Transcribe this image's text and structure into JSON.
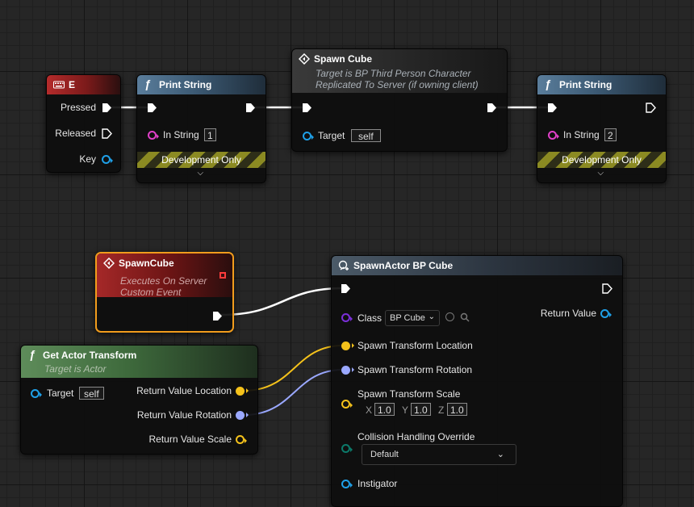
{
  "nodes": {
    "key_e": {
      "title": "E",
      "pins": {
        "pressed": "Pressed",
        "released": "Released",
        "key": "Key"
      }
    },
    "print1": {
      "title": "Print String",
      "in_string_label": "In String",
      "in_string_value": "1",
      "dev": "Development Only"
    },
    "spawn_cube_call": {
      "title": "Spawn Cube",
      "sub1": "Target is BP Third Person Character",
      "sub2": "Replicated To Server (if owning client)",
      "target_label": "Target",
      "target_value": "self"
    },
    "print2": {
      "title": "Print String",
      "in_string_label": "In String",
      "in_string_value": "2",
      "dev": "Development Only"
    },
    "custom_event": {
      "title": "SpawnCube",
      "sub1": "Executes On Server",
      "sub2": "Custom Event"
    },
    "get_transform": {
      "title": "Get Actor Transform",
      "sub": "Target is Actor",
      "target_label": "Target",
      "target_value": "self",
      "out_location": "Return Value Location",
      "out_rotation": "Return Value Rotation",
      "out_scale": "Return Value Scale"
    },
    "spawn_actor": {
      "title": "SpawnActor BP Cube",
      "return_value": "Return Value",
      "class_label": "Class",
      "class_value": "BP Cube",
      "loc": "Spawn Transform Location",
      "rot": "Spawn Transform Rotation",
      "scale": "Spawn Transform Scale",
      "x_label": "X",
      "x_value": "1.0",
      "y_label": "Y",
      "y_value": "1.0",
      "z_label": "Z",
      "z_value": "1.0",
      "collision": "Collision Handling Override",
      "collision_value": "Default",
      "instigator": "Instigator"
    }
  },
  "colors": {
    "exec": "#ffffff",
    "string_pin": "#e040c8",
    "object_pin": "#1fa0e8",
    "class_pin": "#7b2fd9",
    "vector_pin": "#f5c21b",
    "rotator_pin": "#9aa8ff",
    "enum_pin": "#0c7a6a",
    "selected_outline": "#f19c1c"
  }
}
